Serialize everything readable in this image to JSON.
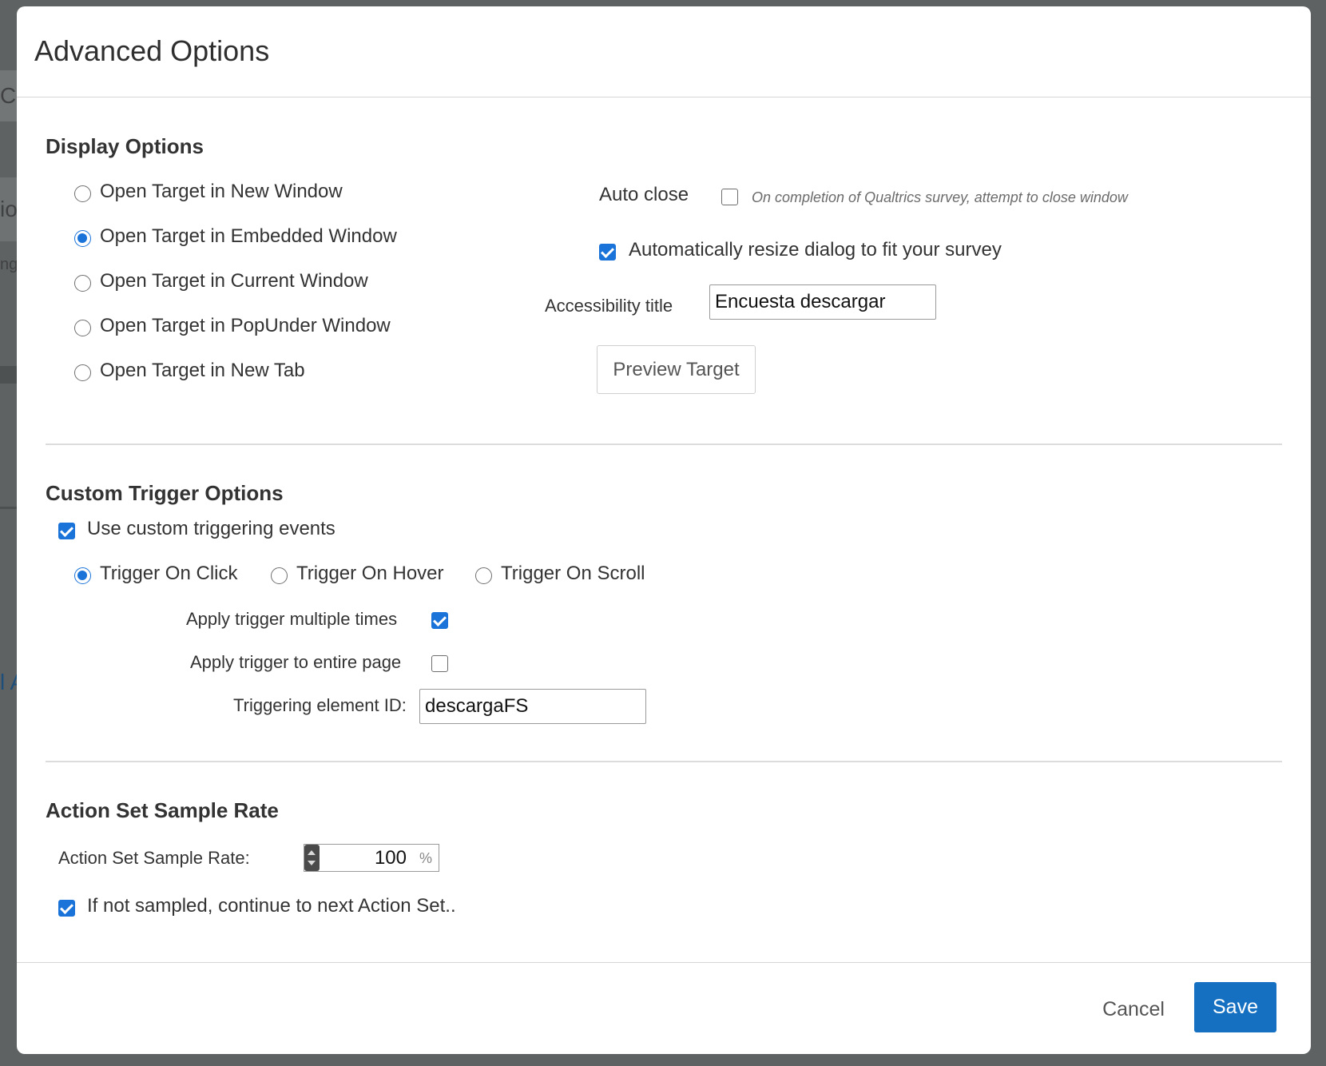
{
  "background": {
    "fragments": [
      "Cu",
      "io",
      "ng",
      "l A"
    ]
  },
  "dialog": {
    "title": "Advanced Options"
  },
  "display_options": {
    "title": "Display Options",
    "radios": [
      {
        "label": "Open Target in New Window",
        "checked": false
      },
      {
        "label": "Open Target in Embedded Window",
        "checked": true
      },
      {
        "label": "Open Target in Current Window",
        "checked": false
      },
      {
        "label": "Open Target in PopUnder Window",
        "checked": false
      },
      {
        "label": "Open Target in New Tab",
        "checked": false
      }
    ],
    "auto_close": {
      "label": "Auto close",
      "checked": false,
      "hint": "On completion of Qualtrics survey, attempt to close window"
    },
    "auto_resize": {
      "label": "Automatically resize dialog to fit your survey",
      "checked": true
    },
    "accessibility": {
      "label": "Accessibility title",
      "value": "Encuesta descargar"
    },
    "preview_button": "Preview Target"
  },
  "custom_trigger": {
    "title": "Custom Trigger Options",
    "use_custom": {
      "label": "Use custom triggering events",
      "checked": true
    },
    "triggers": [
      {
        "label": "Trigger On Click",
        "checked": true
      },
      {
        "label": "Trigger On Hover",
        "checked": false
      },
      {
        "label": "Trigger On Scroll",
        "checked": false
      }
    ],
    "apply_multiple": {
      "label": "Apply trigger multiple times",
      "checked": true
    },
    "apply_entire": {
      "label": "Apply trigger to entire page",
      "checked": false
    },
    "element_id": {
      "label": "Triggering element ID:",
      "value": "descargaFS"
    }
  },
  "sample_rate": {
    "title": "Action Set Sample Rate",
    "label": "Action Set Sample Rate:",
    "value": "100",
    "unit": "%",
    "continue": {
      "label": "If not sampled, continue to next Action Set..",
      "checked": true
    }
  },
  "footer": {
    "cancel": "Cancel",
    "save": "Save"
  },
  "colors": {
    "accent": "#1a73d9",
    "save_button": "#1570c1",
    "overlay": "#5f6263"
  }
}
